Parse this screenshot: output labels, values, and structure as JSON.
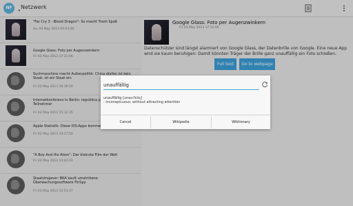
{
  "actionbar": {
    "app_icon_text": "NF",
    "title": "Netzwerk",
    "icons": [
      "reader-icon",
      "overflow-menu-icon"
    ]
  },
  "list": [
    {
      "title": "\"Far Cry 3 - Blood Dragon\": So macht Trash Spaß",
      "date": "Sa, 04 May 2013 09:03:46",
      "thumb": "photo"
    },
    {
      "title": "Google Glass: Foto per Augenzwinkern",
      "date": "Fri 03 May 2013 17:31:06",
      "thumb": "photo"
    },
    {
      "title": "Suchmaschine macht Außenpolitik: China dürfen ist kein Staat, ist ein Staat ein",
      "date": "Fri 03 May 2013 16:16:50",
      "thumb": "globe"
    },
    {
      "title": "Internetkonferenz in Berlin: republica provides 5.000 Teilnehmer",
      "date": "Fri 03 May 2013 15:12:35",
      "thumb": "globe"
    },
    {
      "title": "Apple-Statistik: Diese iOS-Apps kommen am besten an",
      "date": "Fri 03 May 2013 14:27:50",
      "thumb": "globe"
    },
    {
      "title": "\"A Boy And His Atom\": Der kleinste Film der Welt",
      "date": "Fri 03 May 2013 13:42:20",
      "thumb": "globe"
    },
    {
      "title": "Staatstrojaner: BKA kauft umstrittene Überwachungssoftware FinSpy",
      "date": "Fri 03 May 2013 12:53:27",
      "thumb": "globe"
    }
  ],
  "detail": {
    "title": "Google Glass: Foto per Augenzwinkern",
    "date": "Fri 03 May 2013 17:31:06",
    "body": "Datenschützer sind längst alarmiert von Google Glass, der Datenbrille von Google. Eine neue App wird sie kaum beruhigen: Damit könnten Träger der Brille ganz unauffällig ein Foto schießen.",
    "fulltext_label": "Full text",
    "webpage_label": "Go to webpage"
  },
  "dialog": {
    "input_value": "unauffällig",
    "definition_line1": "unauffällig [unauˈfɛlɪç]",
    "definition_line2": ": inconspicuous; without attracting attention",
    "cancel_label": "Cancel",
    "wikipedia_label": "Wikipedia",
    "wiktionary_label": "Wiktionary"
  },
  "colors": {
    "accent": "#44aad6",
    "button_blue": "#3b9fd8"
  }
}
